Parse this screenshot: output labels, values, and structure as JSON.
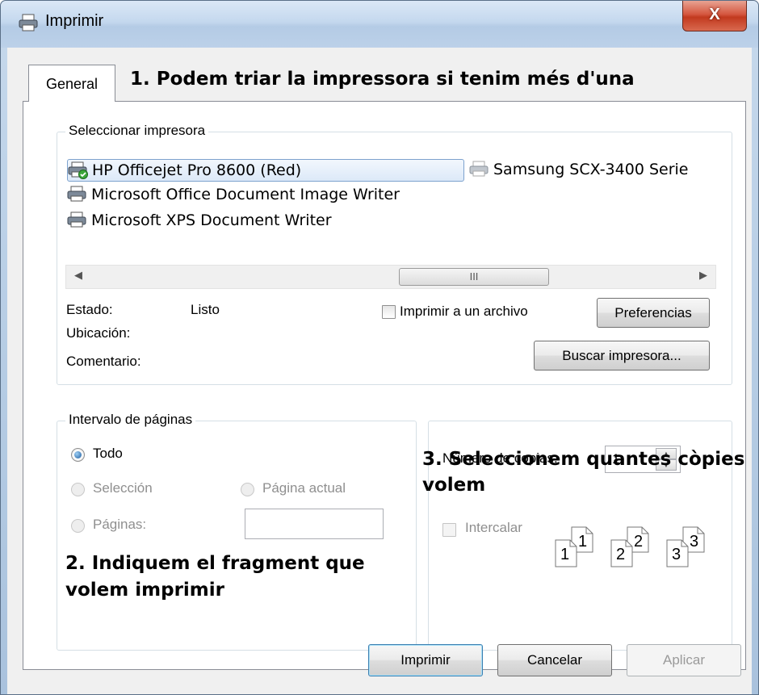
{
  "window": {
    "title": "Imprimir",
    "close_label": "X"
  },
  "tabs": [
    {
      "label": "General"
    }
  ],
  "annotations": {
    "a1": "1. Podem triar la impressora si tenim més d'una",
    "a2_line1": "2. Indiquem el fragment que",
    "a2_line2": "volem imprimir",
    "a3_line1": "3. Seleccionem quantes còpies",
    "a3_line2": "volem"
  },
  "select_printer": {
    "legend": "Seleccionar impresora",
    "printers": [
      {
        "name": "HP Officejet Pro 8600 (Red)",
        "selected": true,
        "default": true
      },
      {
        "name": "Samsung SCX-3400 Serie",
        "selected": false
      },
      {
        "name": "Microsoft Office Document Image Writer",
        "selected": false
      },
      {
        "name": "Microsoft XPS Document Writer",
        "selected": false
      }
    ],
    "scroll_thumb_glyph": "III",
    "status_label": "Estado:",
    "status_value": "Listo",
    "location_label": "Ubicación:",
    "comment_label": "Comentario:",
    "print_to_file_label": "Imprimir a un archivo",
    "print_to_file_checked": false,
    "preferences_label": "Preferencias",
    "find_printer_label": "Buscar impresora..."
  },
  "page_range": {
    "legend": "Intervalo de páginas",
    "all_label": "Todo",
    "selection_label": "Selección",
    "current_page_label": "Página actual",
    "pages_label": "Páginas:",
    "pages_value": "",
    "selected_option": "Todo"
  },
  "copies": {
    "count_label": "Número de copias:",
    "count_value": "1",
    "collate_label": "Intercalar",
    "collate_checked": false,
    "collate_pages": [
      "1",
      "2",
      "3"
    ]
  },
  "footer": {
    "print_label": "Imprimir",
    "cancel_label": "Cancelar",
    "apply_label": "Aplicar"
  },
  "colors": {
    "accent": "#3c7fb1",
    "close": "#c23a1f",
    "frame": "#b9cfe6"
  }
}
